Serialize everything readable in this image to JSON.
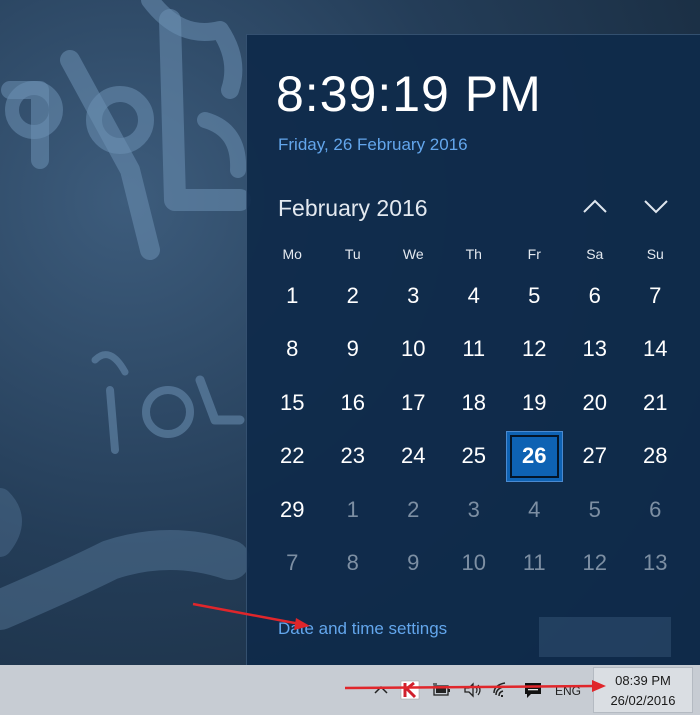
{
  "clock": {
    "time": "8:39:19 PM",
    "date": "Friday, 26 February 2016"
  },
  "calendar": {
    "month_title": "February 2016",
    "days_of_week": [
      "Mo",
      "Tu",
      "We",
      "Th",
      "Fr",
      "Sa",
      "Su"
    ],
    "weeks": [
      [
        "1",
        "2",
        "3",
        "4",
        "5",
        "6",
        "7"
      ],
      [
        "8",
        "9",
        "10",
        "11",
        "12",
        "13",
        "14"
      ],
      [
        "15",
        "16",
        "17",
        "18",
        "19",
        "20",
        "21"
      ],
      [
        "22",
        "23",
        "24",
        "25",
        "26",
        "27",
        "28"
      ],
      [
        "29",
        "1",
        "2",
        "3",
        "4",
        "5",
        "6"
      ],
      [
        "7",
        "8",
        "9",
        "10",
        "11",
        "12",
        "13"
      ]
    ],
    "today": "26",
    "nav": {
      "prev_icon": "chevron-up-icon",
      "next_icon": "chevron-down-icon"
    }
  },
  "settings_link": "Date and time settings",
  "taskbar": {
    "tray_icons": [
      "chevron-up-icon",
      "kaspersky-icon",
      "battery-icon",
      "volume-icon",
      "wifi-icon",
      "action-center-icon"
    ],
    "language": "ENG",
    "time": "08:39 PM",
    "date": "26/02/2016"
  },
  "colors": {
    "flyout_bg": "#0f2b4a",
    "accent_link": "#63a6ec",
    "today_highlight": "#0e62b3",
    "annotation_arrow": "#e0262b",
    "taskbar_bg": "#c7ccd3"
  }
}
